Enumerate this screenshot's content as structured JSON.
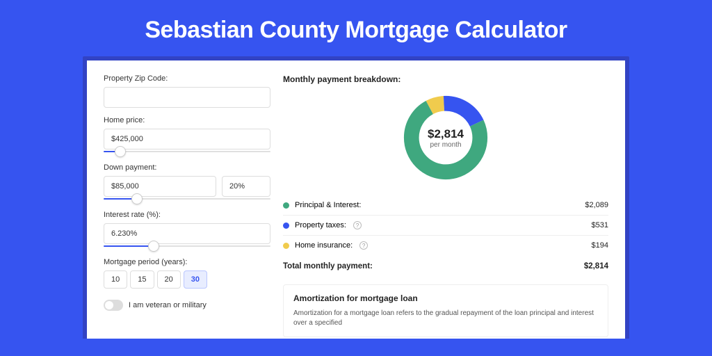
{
  "title": "Sebastian County Mortgage Calculator",
  "colors": {
    "principal": "#3fa87f",
    "taxes": "#3654f0",
    "insurance": "#f0cb4d"
  },
  "form": {
    "zip": {
      "label": "Property Zip Code:",
      "value": ""
    },
    "price": {
      "label": "Home price:",
      "value": "$425,000",
      "slider_pct": 10
    },
    "down": {
      "label": "Down payment:",
      "amount": "$85,000",
      "percent": "20%",
      "slider_pct": 20
    },
    "rate": {
      "label": "Interest rate (%):",
      "value": "6.230%",
      "slider_pct": 30
    },
    "period": {
      "label": "Mortgage period (years):",
      "options": [
        "10",
        "15",
        "20",
        "30"
      ],
      "selected": "30"
    },
    "veteran": {
      "label": "I am veteran or military",
      "on": false
    }
  },
  "breakdown": {
    "title": "Monthly payment breakdown:",
    "center_amount": "$2,814",
    "center_per": "per month",
    "items": [
      {
        "key": "principal",
        "label": "Principal & Interest:",
        "value": "$2,089",
        "info": false,
        "color": "#3fa87f",
        "pct": 74
      },
      {
        "key": "taxes",
        "label": "Property taxes:",
        "value": "$531",
        "info": true,
        "color": "#3654f0",
        "pct": 19
      },
      {
        "key": "insurance",
        "label": "Home insurance:",
        "value": "$194",
        "info": true,
        "color": "#f0cb4d",
        "pct": 7
      }
    ],
    "total_label": "Total monthly payment:",
    "total_value": "$2,814"
  },
  "amortization": {
    "title": "Amortization for mortgage loan",
    "text": "Amortization for a mortgage loan refers to the gradual repayment of the loan principal and interest over a specified"
  },
  "chart_data": {
    "type": "pie",
    "title": "Monthly payment breakdown",
    "categories": [
      "Principal & Interest",
      "Property taxes",
      "Home insurance"
    ],
    "values": [
      2089,
      531,
      194
    ],
    "total": 2814,
    "unit": "USD/month"
  }
}
